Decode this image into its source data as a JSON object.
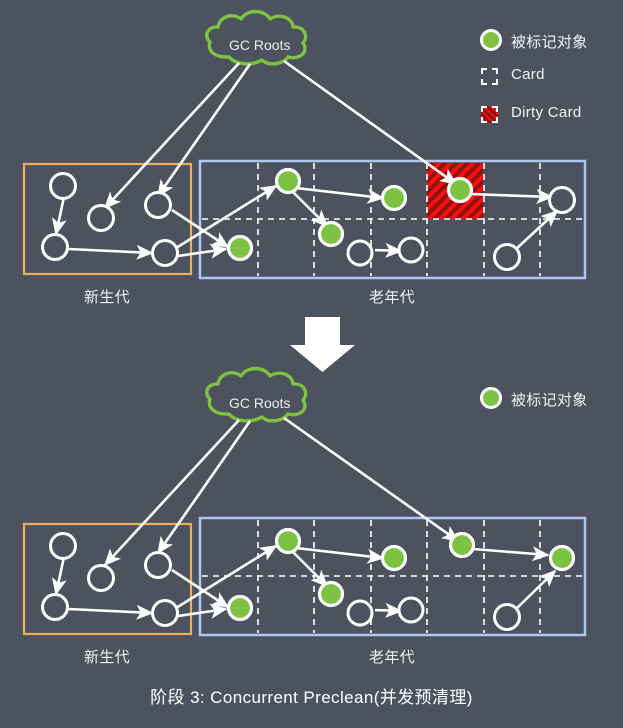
{
  "caption": "阶段 3: Concurrent Preclean(并发预清理)",
  "colors": {
    "background": "#4d525f",
    "marked_node": "#7dc242",
    "node_ring": "#ffffff",
    "unmarked_node": "#4d525f",
    "young_border": "#e8b060",
    "old_border": "#aec6f0",
    "cloud_border": "#7dc242",
    "dirty_card_fill": "#8d1212",
    "dirty_card_stripe": "#ff0d0d",
    "card_divider": "#ffffff",
    "arrow": "#ffffff",
    "text": "#f2f4f7"
  },
  "legend_top": {
    "items": [
      {
        "icon": "green-circle-icon",
        "label": "被标记对象"
      },
      {
        "icon": "dashed-square-icon",
        "label": "Card"
      },
      {
        "icon": "hatched-square-icon",
        "label": "Dirty Card"
      }
    ]
  },
  "legend_bottom": {
    "items": [
      {
        "icon": "green-circle-icon",
        "label": "被标记对象"
      }
    ]
  },
  "diagram_top": {
    "gc_roots_label": "GC Roots",
    "young_gen_label": "新生代",
    "old_gen_label": "老年代",
    "dirty_card_present": true,
    "marked_count": 5,
    "unmarked_count": 9
  },
  "diagram_bottom": {
    "gc_roots_label": "GC Roots",
    "young_gen_label": "新生代",
    "old_gen_label": "老年代",
    "dirty_card_present": false,
    "marked_count": 6,
    "unmarked_count": 8
  },
  "transition": {
    "icon": "down-arrow-icon",
    "meaning": "proceeds-to"
  }
}
